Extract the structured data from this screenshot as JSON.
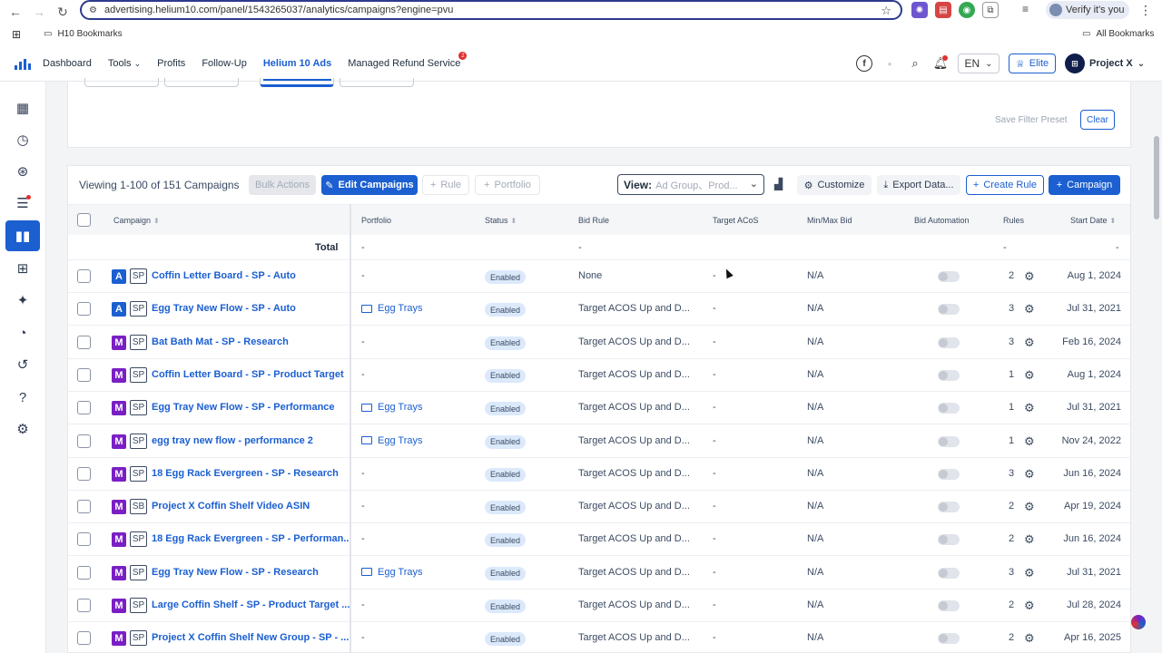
{
  "browser": {
    "url": "advertising.helium10.com/panel/1543265037/analytics/campaigns?engine=pvu",
    "verify_label": "Verify it's you",
    "bookmarks_folder": "H10 Bookmarks",
    "all_bookmarks": "All Bookmarks"
  },
  "header": {
    "nav": [
      "Dashboard",
      "Tools",
      "Profits",
      "Follow-Up",
      "Helium 10 Ads",
      "Managed Refund Service"
    ],
    "refund_badge": "2",
    "lang": "EN",
    "plan": "Elite",
    "project": "Project X"
  },
  "filters": {
    "save_preset": "Save Filter Preset",
    "clear": "Clear"
  },
  "toolbar": {
    "viewing": "Viewing 1-100 of 151 Campaigns",
    "bulk_actions": "Bulk Actions",
    "edit_campaigns": "Edit Campaigns",
    "rule": "Rule",
    "portfolio": "Portfolio",
    "view_label": "View:",
    "view_value": "Ad Group、Prod...",
    "customize": "Customize",
    "export": "Export Data...",
    "create_rule": "Create Rule",
    "campaign": "Campaign"
  },
  "columns": {
    "campaign": "Campaign",
    "portfolio": "Portfolio",
    "status": "Status",
    "bid_rule": "Bid Rule",
    "target_acos": "Target ACoS",
    "min_max_bid": "Min/Max Bid",
    "bid_automation": "Bid Automation",
    "rules": "Rules",
    "start_date": "Start Date"
  },
  "total_row": {
    "label": "Total",
    "portfolio": "-",
    "bid_rule": "-",
    "rules": "-",
    "start_date": "-"
  },
  "rows": [
    {
      "type": "A",
      "ad": "SP",
      "name": "Coffin Letter Board - SP - Auto",
      "portfolio": "-",
      "status": "Enabled",
      "bid_rule": "None",
      "acos": "-",
      "minmax": "N/A",
      "rules": "2",
      "start": "Aug 1, 2024"
    },
    {
      "type": "A",
      "ad": "SP",
      "name": "Egg Tray New Flow - SP - Auto",
      "portfolio": "Egg Trays",
      "status": "Enabled",
      "bid_rule": "Target ACOS Up and D...",
      "acos": "-",
      "minmax": "N/A",
      "rules": "3",
      "start": "Jul 31, 2021"
    },
    {
      "type": "M",
      "ad": "SP",
      "name": "Bat Bath Mat - SP - Research",
      "portfolio": "-",
      "status": "Enabled",
      "bid_rule": "Target ACOS Up and D...",
      "acos": "-",
      "minmax": "N/A",
      "rules": "3",
      "start": "Feb 16, 2024"
    },
    {
      "type": "M",
      "ad": "SP",
      "name": "Coffin Letter Board - SP - Product Target",
      "portfolio": "-",
      "status": "Enabled",
      "bid_rule": "Target ACOS Up and D...",
      "acos": "-",
      "minmax": "N/A",
      "rules": "1",
      "start": "Aug 1, 2024"
    },
    {
      "type": "M",
      "ad": "SP",
      "name": "Egg Tray New Flow - SP - Performance",
      "portfolio": "Egg Trays",
      "status": "Enabled",
      "bid_rule": "Target ACOS Up and D...",
      "acos": "-",
      "minmax": "N/A",
      "rules": "1",
      "start": "Jul 31, 2021"
    },
    {
      "type": "M",
      "ad": "SP",
      "name": "egg tray new flow - performance 2",
      "portfolio": "Egg Trays",
      "status": "Enabled",
      "bid_rule": "Target ACOS Up and D...",
      "acos": "-",
      "minmax": "N/A",
      "rules": "1",
      "start": "Nov 24, 2022"
    },
    {
      "type": "M",
      "ad": "SP",
      "name": "18 Egg Rack Evergreen - SP - Research",
      "portfolio": "-",
      "status": "Enabled",
      "bid_rule": "Target ACOS Up and D...",
      "acos": "-",
      "minmax": "N/A",
      "rules": "3",
      "start": "Jun 16, 2024"
    },
    {
      "type": "M",
      "ad": "SB",
      "name": "Project X Coffin Shelf Video ASIN",
      "portfolio": "-",
      "status": "Enabled",
      "bid_rule": "Target ACOS Up and D...",
      "acos": "-",
      "minmax": "N/A",
      "rules": "2",
      "start": "Apr 19, 2024"
    },
    {
      "type": "M",
      "ad": "SP",
      "name": "18 Egg Rack Evergreen - SP - Performan...",
      "portfolio": "-",
      "status": "Enabled",
      "bid_rule": "Target ACOS Up and D...",
      "acos": "-",
      "minmax": "N/A",
      "rules": "2",
      "start": "Jun 16, 2024"
    },
    {
      "type": "M",
      "ad": "SP",
      "name": "Egg Tray New Flow - SP - Research",
      "portfolio": "Egg Trays",
      "status": "Enabled",
      "bid_rule": "Target ACOS Up and D...",
      "acos": "-",
      "minmax": "N/A",
      "rules": "3",
      "start": "Jul 31, 2021"
    },
    {
      "type": "M",
      "ad": "SP",
      "name": "Large Coffin Shelf - SP - Product Target ...",
      "portfolio": "-",
      "status": "Enabled",
      "bid_rule": "Target ACOS Up and D...",
      "acos": "-",
      "minmax": "N/A",
      "rules": "2",
      "start": "Jul 28, 2024"
    },
    {
      "type": "M",
      "ad": "SP",
      "name": "Project X Coffin Shelf New Group - SP - ...",
      "portfolio": "-",
      "status": "Enabled",
      "bid_rule": "Target ACOS Up and D...",
      "acos": "-",
      "minmax": "N/A",
      "rules": "2",
      "start": "Apr 16, 2025"
    }
  ]
}
